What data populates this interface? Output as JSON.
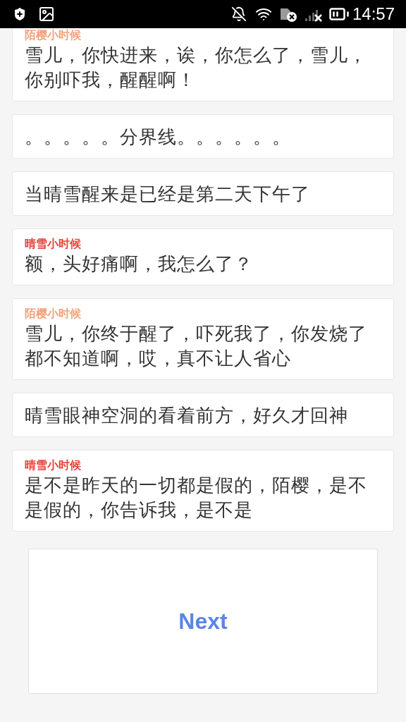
{
  "status_bar": {
    "time": "14:57"
  },
  "messages": [
    {
      "kind": "dialogue",
      "speaker": "陌樱小时候",
      "color": "#f4a27a",
      "text": "雪儿，你快进来，诶，你怎么了，雪儿，你别吓我，醒醒啊！"
    },
    {
      "kind": "narration",
      "text": "。。。。。分界线。。。。。。"
    },
    {
      "kind": "narration",
      "text": "当晴雪醒来是已经是第二天下午了"
    },
    {
      "kind": "dialogue",
      "speaker": "晴雪小时候",
      "color": "#e8413c",
      "text": "额，头好痛啊，我怎么了？"
    },
    {
      "kind": "dialogue",
      "speaker": "陌樱小时候",
      "color": "#f4a27a",
      "text": "雪儿，你终于醒了，吓死我了，你发烧了都不知道啊，哎，真不让人省心"
    },
    {
      "kind": "narration",
      "text": "晴雪眼神空洞的看着前方，好久才回神"
    },
    {
      "kind": "dialogue",
      "speaker": "晴雪小时候",
      "color": "#e8413c",
      "text": "是不是昨天的一切都是假的，陌樱，是不是假的，你告诉我，是不是"
    }
  ],
  "button": {
    "label": "Next"
  }
}
